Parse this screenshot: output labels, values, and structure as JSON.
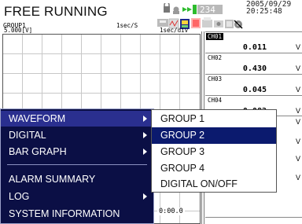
{
  "header": {
    "mode_title": "FREE RUNNING",
    "group_name": "GROUP1",
    "sample_rate": "1sec/S",
    "memory_counter": "234",
    "date": "2005/09/29",
    "time": "20:25:48"
  },
  "trend": {
    "scale_min": "5.000[V]",
    "time_div": "1sec/div",
    "time_label": "0:00.0"
  },
  "channels": [
    {
      "name": "CH01",
      "value": "0.011",
      "unit": "V",
      "selected": true
    },
    {
      "name": "CH02",
      "value": "0.430",
      "unit": "V",
      "selected": false
    },
    {
      "name": "CH03",
      "value": "0.045",
      "unit": "V",
      "selected": false
    },
    {
      "name": "CH04",
      "value": "0.082",
      "unit": "V",
      "selected": false
    }
  ],
  "unit_marks": [
    "V",
    "V",
    "V",
    "V"
  ],
  "menu": {
    "items": [
      {
        "label": "WAVEFORM",
        "has_submenu": true
      },
      {
        "label": "DIGITAL",
        "has_submenu": true
      },
      {
        "label": "BAR GRAPH",
        "has_submenu": true
      },
      {
        "label": "ALARM SUMMARY",
        "has_submenu": false
      },
      {
        "label": "LOG",
        "has_submenu": true
      },
      {
        "label": "SYSTEM INFORMATION",
        "has_submenu": false
      }
    ]
  },
  "submenu": {
    "items": [
      {
        "label": "GROUP 1"
      },
      {
        "label": "GROUP 2"
      },
      {
        "label": "GROUP 3"
      },
      {
        "label": "GROUP 4"
      },
      {
        "label": "DIGITAL ON/OFF"
      }
    ]
  },
  "colors": {
    "menu_bg": "#0b0f45",
    "menu_highlight": "#2a2f8f",
    "submenu_highlight": "#0b1a6e",
    "counter_bg": "#b9b9b9",
    "status_green": "#2dbb2d"
  }
}
